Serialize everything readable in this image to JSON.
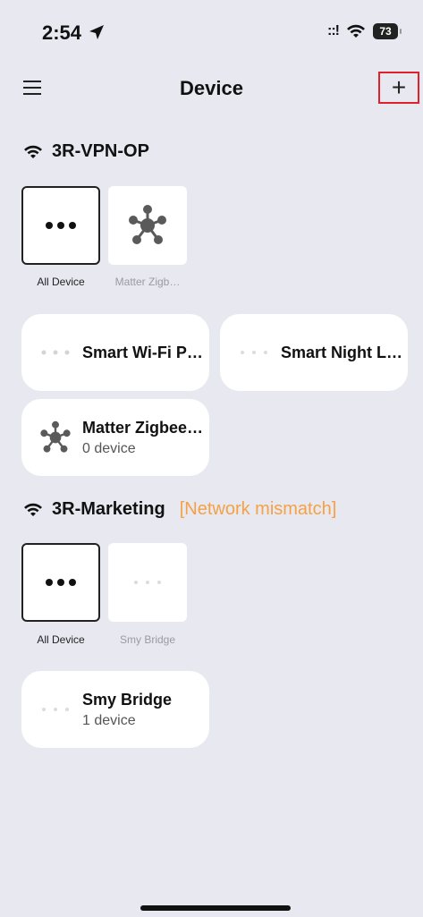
{
  "status": {
    "time": "2:54",
    "signal": "::!",
    "battery": "73"
  },
  "nav": {
    "title": "Device",
    "add_label": "+"
  },
  "networks": [
    {
      "ssid": "3R-VPN-OP",
      "warning": "",
      "tiles": [
        {
          "label": "All Device",
          "icon": "more-dots-icon",
          "selected": true
        },
        {
          "label": "Matter Zigb…",
          "icon": "hub-icon",
          "selected": false
        }
      ],
      "cards": [
        {
          "name": "Smart Wi-Fi P…",
          "sub": "",
          "icon": "loading-dots-icon"
        },
        {
          "name": "Smart Night L…",
          "sub": "",
          "icon": "loading-dots-icon"
        },
        {
          "name": "Matter Zigbee…",
          "sub": "0 device",
          "icon": "hub-icon"
        }
      ]
    },
    {
      "ssid": "3R-Marketing",
      "warning": "[Network mismatch]",
      "tiles": [
        {
          "label": "All Device",
          "icon": "more-dots-icon",
          "selected": true
        },
        {
          "label": "Smy Bridge",
          "icon": "loading-dots-icon",
          "selected": false
        }
      ],
      "cards": [
        {
          "name": "Smy Bridge",
          "sub": "1 device",
          "icon": "loading-dots-icon"
        }
      ]
    }
  ],
  "colors": {
    "background": "#E8E8F1",
    "warning": "#F5A144",
    "highlight_border": "#E0202A"
  }
}
